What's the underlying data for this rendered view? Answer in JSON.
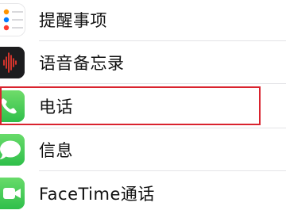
{
  "settings_list": {
    "items": [
      {
        "label": "提醒事项",
        "icon": "reminders-icon"
      },
      {
        "label": "语音备忘录",
        "icon": "voice-memos-icon"
      },
      {
        "label": "电话",
        "icon": "phone-icon"
      },
      {
        "label": "信息",
        "icon": "messages-icon"
      },
      {
        "label": "FaceTime通话",
        "icon": "facetime-icon"
      }
    ],
    "highlighted_item": "电话"
  },
  "colors": {
    "highlight_border": "#d9232e",
    "phone_icon_bg": "#49c35a",
    "messages_icon_bg": "#3fc650",
    "facetime_icon_bg": "#3fc650",
    "voice_memos_icon_bg": "#1c1c1e",
    "voice_wave": "#ff3b30",
    "separator": "#e3e3e6"
  }
}
